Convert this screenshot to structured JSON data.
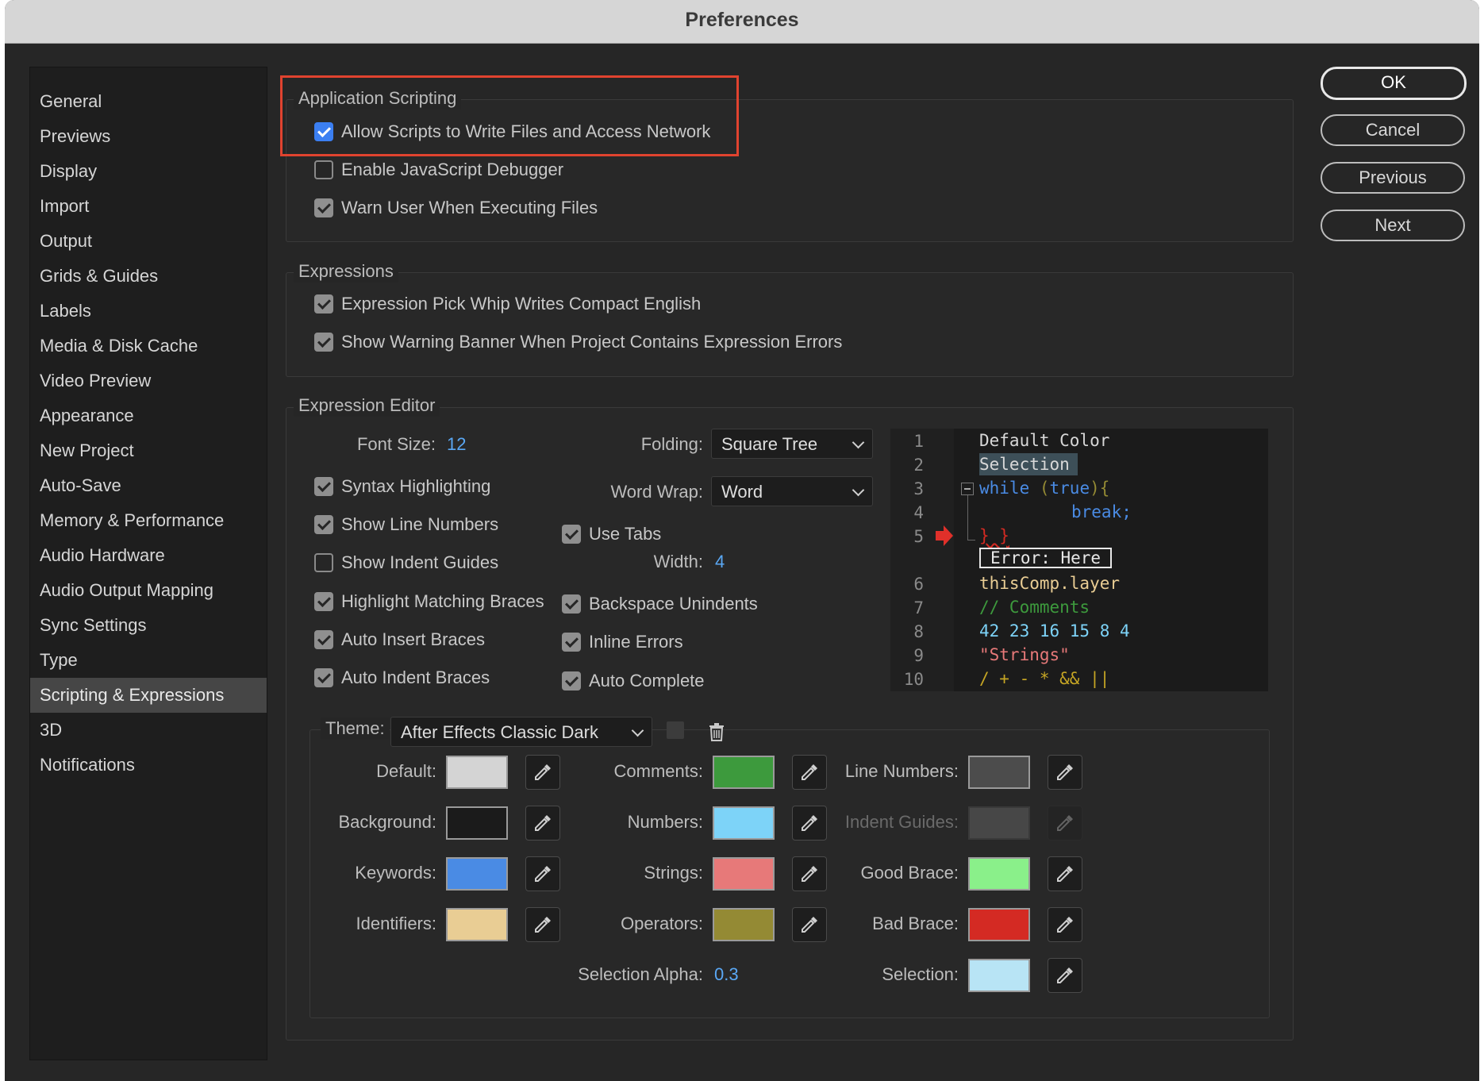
{
  "window": {
    "title": "Preferences"
  },
  "sidebar": {
    "items": [
      {
        "label": "General"
      },
      {
        "label": "Previews"
      },
      {
        "label": "Display"
      },
      {
        "label": "Import"
      },
      {
        "label": "Output"
      },
      {
        "label": "Grids & Guides"
      },
      {
        "label": "Labels"
      },
      {
        "label": "Media & Disk Cache"
      },
      {
        "label": "Video Preview"
      },
      {
        "label": "Appearance"
      },
      {
        "label": "New Project"
      },
      {
        "label": "Auto-Save"
      },
      {
        "label": "Memory & Performance"
      },
      {
        "label": "Audio Hardware"
      },
      {
        "label": "Audio Output Mapping"
      },
      {
        "label": "Sync Settings"
      },
      {
        "label": "Type"
      },
      {
        "label": "Scripting & Expressions",
        "selected": true
      },
      {
        "label": "3D"
      },
      {
        "label": "Notifications"
      }
    ]
  },
  "buttons": {
    "ok": "OK",
    "cancel": "Cancel",
    "previous": "Previous",
    "next": "Next"
  },
  "app_scripting": {
    "title": "Application Scripting",
    "allow_scripts": {
      "label": "Allow Scripts to Write Files and Access Network",
      "checked": true
    },
    "js_debugger": {
      "label": "Enable JavaScript Debugger",
      "checked": false
    },
    "warn_user": {
      "label": "Warn User When Executing Files",
      "checked": true
    }
  },
  "expressions": {
    "title": "Expressions",
    "pick_whip": {
      "label": "Expression Pick Whip Writes Compact English",
      "checked": true
    },
    "warning_banner": {
      "label": "Show Warning Banner When Project Contains Expression Errors",
      "checked": true
    }
  },
  "editor": {
    "title": "Expression Editor",
    "font_size_label": "Font Size:",
    "font_size_value": "12",
    "folding_label": "Folding:",
    "folding_value": "Square Tree",
    "word_wrap_label": "Word Wrap:",
    "word_wrap_value": "Word",
    "syntax_highlighting": {
      "label": "Syntax Highlighting",
      "checked": true
    },
    "show_line_numbers": {
      "label": "Show Line Numbers",
      "checked": true
    },
    "show_indent_guides": {
      "label": "Show Indent Guides",
      "checked": false
    },
    "highlight_braces": {
      "label": "Highlight Matching Braces",
      "checked": true
    },
    "auto_insert_braces": {
      "label": "Auto Insert Braces",
      "checked": true
    },
    "auto_indent_braces": {
      "label": "Auto Indent Braces",
      "checked": true
    },
    "use_tabs": {
      "label": "Use Tabs",
      "checked": true
    },
    "width_label": "Width:",
    "width_value": "4",
    "backspace_unindents": {
      "label": "Backspace Unindents",
      "checked": true
    },
    "inline_errors": {
      "label": "Inline Errors",
      "checked": true
    },
    "auto_complete": {
      "label": "Auto Complete",
      "checked": true
    }
  },
  "preview": {
    "line_numbers": [
      "1",
      "2",
      "3",
      "4",
      "5",
      "6",
      "7",
      "8",
      "9",
      "10"
    ],
    "lines": {
      "l1": "Default Color",
      "l2": "Selection",
      "l3_kw": "while",
      "l3_rest_a": " (",
      "l3_true": "true",
      "l3_rest_b": "){",
      "l4": "break;",
      "l5": "} }",
      "error": "Error: Here",
      "l6": "thisComp.layer",
      "l7": "// Comments",
      "l8": "42 23 16 15 8 4",
      "l9": "\"Strings\"",
      "l10": "/ + - * && ||"
    }
  },
  "theme": {
    "label": "Theme:",
    "value": "After Effects Classic Dark",
    "colors": {
      "default": {
        "label": "Default:",
        "color": "#d4d4d4"
      },
      "background": {
        "label": "Background:",
        "color": "#1b1b1b"
      },
      "keywords": {
        "label": "Keywords:",
        "color": "#4a8be4"
      },
      "identifiers": {
        "label": "Identifiers:",
        "color": "#e9cd94"
      },
      "comments": {
        "label": "Comments:",
        "color": "#3d9a3d"
      },
      "numbers": {
        "label": "Numbers:",
        "color": "#7dd3f8"
      },
      "strings": {
        "label": "Strings:",
        "color": "#e77979"
      },
      "operators": {
        "label": "Operators:",
        "color": "#948a34"
      },
      "line_numbers": {
        "label": "Line Numbers:",
        "color": "#4c4c4c"
      },
      "indent_guides": {
        "label": "Indent Guides:",
        "color": "#474747"
      },
      "good_brace": {
        "label": "Good Brace:",
        "color": "#8af08a"
      },
      "bad_brace": {
        "label": "Bad Brace:",
        "color": "#d42a23"
      },
      "selection": {
        "label": "Selection:",
        "color": "#b8e4f5"
      }
    },
    "selection_alpha_label": "Selection Alpha:",
    "selection_alpha_value": "0.3"
  }
}
